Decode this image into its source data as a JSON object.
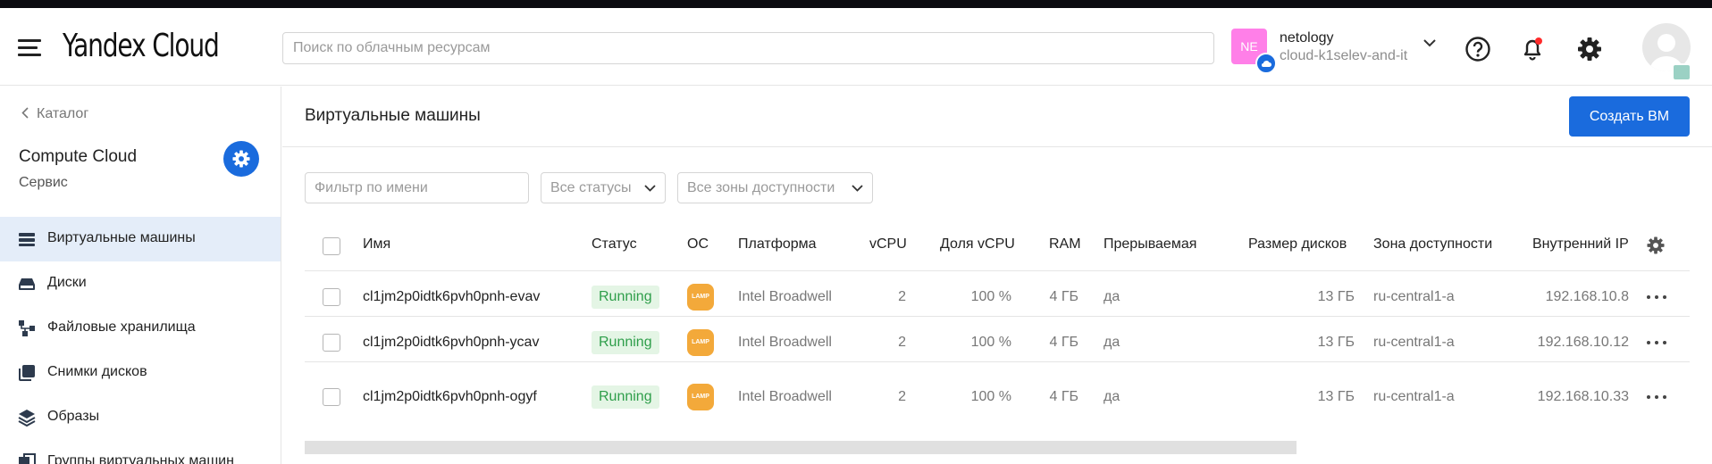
{
  "header": {
    "logo": "Yandex Cloud",
    "search_placeholder": "Поиск по облачным ресурсам",
    "account": {
      "initials": "NE",
      "name": "netology",
      "cloud": "cloud-k1selev-and-it"
    },
    "icons": [
      "menu-icon",
      "help-icon",
      "bell-icon",
      "gear-icon",
      "user-avatar"
    ]
  },
  "sidebar": {
    "breadcrumb": "Каталог",
    "service_title": "Compute Cloud",
    "service_sub": "Сервис",
    "items": [
      {
        "label": "Виртуальные машины",
        "icon": "vm-icon",
        "active": true
      },
      {
        "label": "Диски",
        "icon": "disk-icon",
        "active": false
      },
      {
        "label": "Файловые хранилища",
        "icon": "file-storage-icon",
        "active": false
      },
      {
        "label": "Снимки дисков",
        "icon": "snapshot-icon",
        "active": false
      },
      {
        "label": "Образы",
        "icon": "images-icon",
        "active": false
      },
      {
        "label": "Группы виртуальных машин",
        "icon": "instance-group-icon",
        "active": false
      }
    ]
  },
  "main": {
    "title": "Виртуальные машины",
    "create_button": "Создать ВМ",
    "filter_placeholder": "Фильтр по имени",
    "status_filter": "Все статусы",
    "zone_filter": "Все зоны доступности",
    "columns": [
      "Имя",
      "Статус",
      "ОС",
      "Платформа",
      "vCPU",
      "Доля vCPU",
      "RAM",
      "Прерываемая",
      "Размер дисков",
      "Зона доступности",
      "Внутренний IP"
    ],
    "rows": [
      {
        "name": "cl1jm2p0idtk6pvh0pnh-evav",
        "status": "Running",
        "os": "LAMP",
        "platform": "Intel Broadwell",
        "vcpu": "2",
        "vcpu_share": "100 %",
        "ram": "4 ГБ",
        "preemptible": "да",
        "disk_size": "13 ГБ",
        "zone": "ru-central1-a",
        "ip": "192.168.10.8"
      },
      {
        "name": "cl1jm2p0idtk6pvh0pnh-ycav",
        "status": "Running",
        "os": "LAMP",
        "platform": "Intel Broadwell",
        "vcpu": "2",
        "vcpu_share": "100 %",
        "ram": "4 ГБ",
        "preemptible": "да",
        "disk_size": "13 ГБ",
        "zone": "ru-central1-a",
        "ip": "192.168.10.12"
      },
      {
        "name": "cl1jm2p0idtk6pvh0pnh-ogyf",
        "status": "Running",
        "os": "LAMP",
        "platform": "Intel Broadwell",
        "vcpu": "2",
        "vcpu_share": "100 %",
        "ram": "4 ГБ",
        "preemptible": "да",
        "disk_size": "13 ГБ",
        "zone": "ru-central1-a",
        "ip": "192.168.10.33"
      }
    ]
  },
  "colors": {
    "accent": "#1a6bdd",
    "running_bg": "#e4f5e5",
    "running_text": "#2e9e4a",
    "lamp": "#f3a93a",
    "account_avatar": "#ff7fe8",
    "sidebar_active": "#e4edf9"
  }
}
